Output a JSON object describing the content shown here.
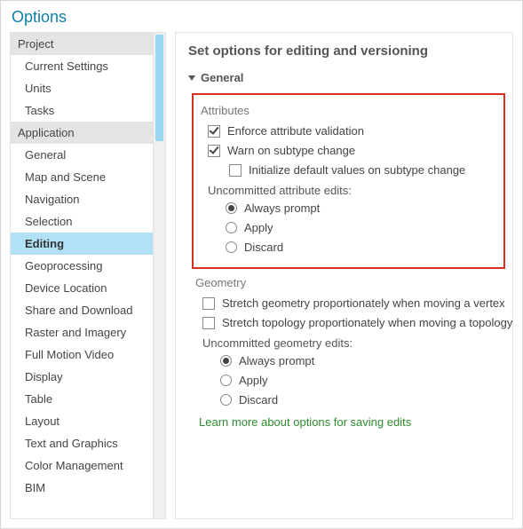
{
  "title": "Options",
  "sidebar": {
    "groups": [
      {
        "header": "Project",
        "items": [
          "Current Settings",
          "Units",
          "Tasks"
        ]
      },
      {
        "header": "Application",
        "items": [
          "General",
          "Map and Scene",
          "Navigation",
          "Selection",
          "Editing",
          "Geoprocessing",
          "Device Location",
          "Share and Download",
          "Raster and Imagery",
          "Full Motion Video",
          "Display",
          "Table",
          "Layout",
          "Text and Graphics",
          "Color Management",
          "BIM"
        ]
      }
    ],
    "selected": "Editing"
  },
  "content": {
    "heading": "Set options for editing and versioning",
    "section_general": "General",
    "attributes": {
      "title": "Attributes",
      "enforce": "Enforce attribute validation",
      "warn": "Warn on subtype change",
      "init": "Initialize default values on subtype change",
      "uncommitted_label": "Uncommitted attribute edits:",
      "opts": {
        "always": "Always prompt",
        "apply": "Apply",
        "discard": "Discard"
      }
    },
    "geometry": {
      "title": "Geometry",
      "stretch_geom": "Stretch geometry proportionately when moving a vertex",
      "stretch_topo": "Stretch topology proportionately when moving a topology elem",
      "uncommitted_label": "Uncommitted geometry edits:",
      "opts": {
        "always": "Always prompt",
        "apply": "Apply",
        "discard": "Discard"
      }
    },
    "learn_more": "Learn more about options for saving edits"
  }
}
